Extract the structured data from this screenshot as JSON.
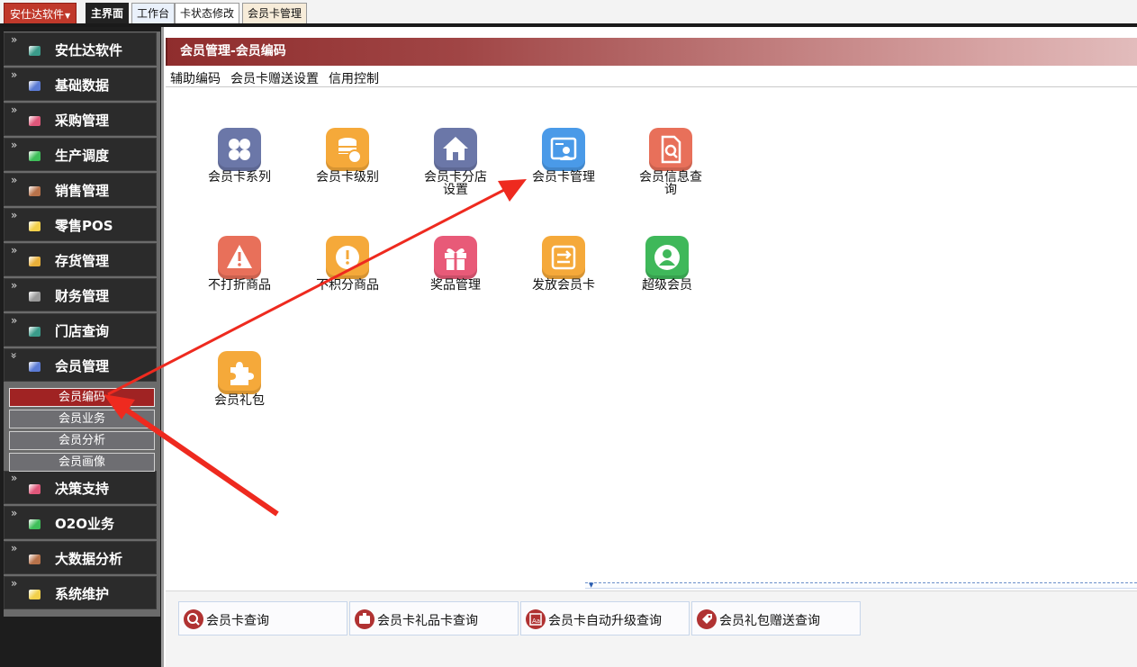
{
  "topbar": {
    "app_menu_label": "安仕达软件",
    "tabs": [
      "主界面",
      "工作台",
      "卡状态修改",
      "会员卡管理"
    ]
  },
  "sidebar": {
    "items": [
      {
        "label": "安仕达软件",
        "icon": "teal-square-icon",
        "color": "#3a9b8a"
      },
      {
        "label": "基础数据",
        "icon": "blue-square-icon",
        "color": "#5b7bd5"
      },
      {
        "label": "采购管理",
        "icon": "pink-square-icon",
        "color": "#e0577a"
      },
      {
        "label": "生产调度",
        "icon": "green-square-icon",
        "color": "#3fbf5a"
      },
      {
        "label": "销售管理",
        "icon": "brown-square-icon",
        "color": "#b8724a"
      },
      {
        "label": "零售POS",
        "icon": "yellow-square-icon",
        "color": "#f2d04a"
      },
      {
        "label": "存货管理",
        "icon": "orange-square-icon",
        "color": "#e8b03a"
      },
      {
        "label": "财务管理",
        "icon": "grey-square-icon",
        "color": "#9a9a9a"
      },
      {
        "label": "门店查询",
        "icon": "teal-square-icon",
        "color": "#3a9b8a"
      },
      {
        "label": "会员管理",
        "icon": "blue-square-icon",
        "color": "#5b7bd5"
      },
      {
        "label": "决策支持",
        "icon": "pink-square-icon",
        "color": "#e0577a"
      },
      {
        "label": "O2O业务",
        "icon": "green-square-icon",
        "color": "#3fbf5a"
      },
      {
        "label": "大数据分析",
        "icon": "brown-square-icon",
        "color": "#b8724a"
      },
      {
        "label": "系统维护",
        "icon": "yellow-square-icon",
        "color": "#f2d04a"
      }
    ],
    "sub_items": [
      "会员编码",
      "会员业务",
      "会员分析",
      "会员画像"
    ]
  },
  "main": {
    "title": "会员管理-会员编码",
    "aux_menu": [
      "辅助编码",
      "会员卡赠送设置",
      "信用控制"
    ],
    "icons": [
      {
        "label": "会员卡系列",
        "icon": "grid-icon",
        "color": "#6b77a8"
      },
      {
        "label": "会员卡级别",
        "icon": "coins-icon",
        "color": "#f5a93a"
      },
      {
        "label": "会员卡分店设置",
        "icon": "house-icon",
        "color": "#6b77a8"
      },
      {
        "label": "会员卡管理",
        "icon": "member-card-icon",
        "color": "#4a9ae8"
      },
      {
        "label": "会员信息查询",
        "icon": "document-search-icon",
        "color": "#e8705a"
      },
      {
        "label": "不打折商品",
        "icon": "warning-icon",
        "color": "#e8705a"
      },
      {
        "label": "不积分商品",
        "icon": "exclamation-icon",
        "color": "#f5a93a"
      },
      {
        "label": "奖品管理",
        "icon": "gift-icon",
        "color": "#e85a78"
      },
      {
        "label": "发放会员卡",
        "icon": "exchange-icon",
        "color": "#f5a93a"
      },
      {
        "label": "超级会员",
        "icon": "user-icon",
        "color": "#3fb85a"
      },
      {
        "label": "会员礼包",
        "icon": "puzzle-icon",
        "color": "#f5a93a"
      }
    ]
  },
  "bottom": {
    "queries": [
      {
        "label": "会员卡查询",
        "icon": "search-icon"
      },
      {
        "label": "会员卡礼品卡查询",
        "icon": "gift-card-icon"
      },
      {
        "label": "会员卡自动升级查询",
        "icon": "card-font-icon"
      },
      {
        "label": "会员礼包赠送查询",
        "icon": "tag-icon"
      }
    ]
  },
  "colors": {
    "accent_red": "#a02323",
    "annotation_arrow": "#ee2a1f"
  }
}
